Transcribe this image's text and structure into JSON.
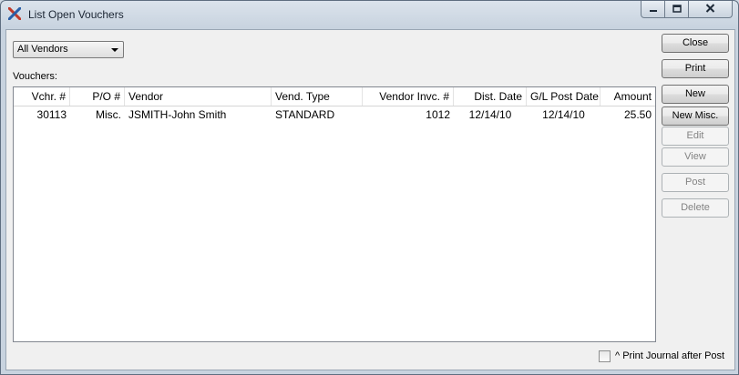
{
  "window": {
    "title": "List Open Vouchers",
    "icons": {
      "app": "xtuple-x-icon",
      "minimize": "minimize-icon",
      "maximize": "maximize-icon",
      "close": "close-icon"
    }
  },
  "filter": {
    "vendor_select_value": "All Vendors"
  },
  "list": {
    "label": "Vouchers:",
    "columns": [
      "Vchr. #",
      "P/O #",
      "Vendor",
      "Vend. Type",
      "Vendor Invc. #",
      "Dist. Date",
      "G/L Post Date",
      "Amount"
    ],
    "rows": [
      [
        "30113",
        "Misc.",
        "JSMITH-John Smith",
        "STANDARD",
        "1012",
        "12/14/10",
        "12/14/10",
        "25.50"
      ]
    ]
  },
  "buttons": {
    "close": "Close",
    "print": "Print",
    "new": "New",
    "new_misc": "New Misc.",
    "edit": "Edit",
    "view": "View",
    "post": "Post",
    "delete": "Delete"
  },
  "options": {
    "print_journal_label": "^ Print Journal after Post",
    "print_journal_checked": false
  },
  "colors": {
    "titlebar": "#dbe3ec",
    "accent_red": "#c0392b",
    "accent_blue": "#2a5fa8"
  }
}
